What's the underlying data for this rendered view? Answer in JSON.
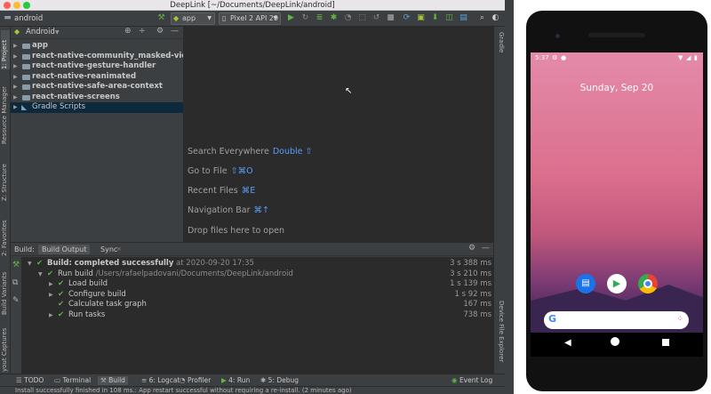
{
  "window": {
    "title": "DeepLink [~/Documents/DeepLink/android]"
  },
  "toolbar": {
    "project_name": "android",
    "run_config": "app",
    "device": "Pixel 2 API 29"
  },
  "left_strip": {
    "project_tab": "1: Project",
    "resource_manager_tab": "Resource Manager",
    "structure_tab": "Z: Structure",
    "favorites_tab": "2: Favorites",
    "build_variants_tab": "Build Variants",
    "layout_captures_tab": "yout Captures"
  },
  "right_strip": {
    "gradle_tab": "Gradle",
    "device_file_explorer_tab": "Device File Explorer"
  },
  "project_panel": {
    "view_mode": "Android",
    "items": [
      {
        "label": "app"
      },
      {
        "label": "react-native-community_masked-view"
      },
      {
        "label": "react-native-gesture-handler"
      },
      {
        "label": "react-native-reanimated"
      },
      {
        "label": "react-native-safe-area-context"
      },
      {
        "label": "react-native-screens"
      },
      {
        "label": "Gradle Scripts"
      }
    ]
  },
  "editor": {
    "hints": [
      {
        "text": "Search Everywhere",
        "key": "Double ⇧"
      },
      {
        "text": "Go to File",
        "key": "⇧⌘O"
      },
      {
        "text": "Recent Files",
        "key": "⌘E"
      },
      {
        "text": "Navigation Bar",
        "key": "⌘↑"
      },
      {
        "text": "Drop files here to open",
        "key": ""
      }
    ]
  },
  "build_panel": {
    "label": "Build:",
    "tabs": [
      {
        "label": "Build Output"
      },
      {
        "label": "Sync"
      }
    ],
    "rows": [
      {
        "status": "Build: completed successfully",
        "detail": "at 2020-09-20 17:35",
        "time": "3 s 388 ms"
      },
      {
        "status": "Run build",
        "detail": "/Users/rafaelpadovani/Documents/DeepLink/android",
        "time": "3 s 210 ms"
      },
      {
        "status": "Load build",
        "detail": "",
        "time": "1 s 139 ms"
      },
      {
        "status": "Configure build",
        "detail": "",
        "time": "1 s 92 ms"
      },
      {
        "status": "Calculate task graph",
        "detail": "",
        "time": "167 ms"
      },
      {
        "status": "Run tasks",
        "detail": "",
        "time": "738 ms"
      }
    ]
  },
  "bottom_bar": {
    "todo": "TODO",
    "terminal": "Terminal",
    "build": "Build",
    "logcat": "6: Logcat",
    "profiler": "Profiler",
    "run": "4: Run",
    "debug": "5: Debug",
    "event_log": "Event Log"
  },
  "status_bar": {
    "message": "Install successfully finished in 108 ms.: App restart successful without requiring a re-install. (2 minutes ago)"
  },
  "emulator": {
    "time": "5:37",
    "date": "Sunday, Sep 20",
    "colors": {
      "wallpaper_top": "#e48aa9",
      "wallpaper_bottom": "#241a3a"
    }
  }
}
